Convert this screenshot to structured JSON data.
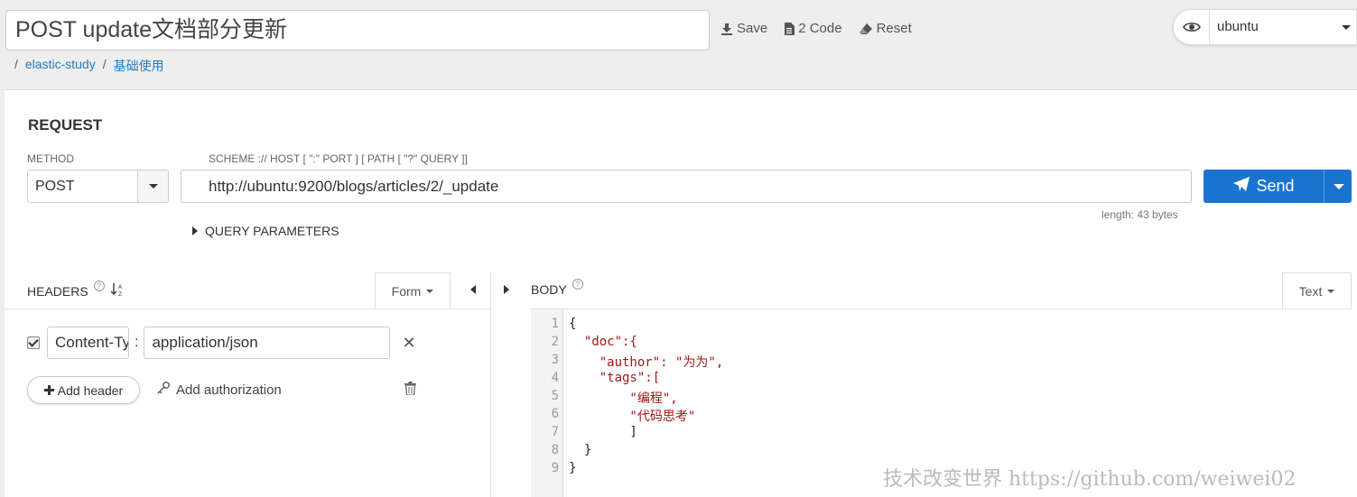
{
  "header": {
    "title": "POST update文档部分更新",
    "save_label": "Save",
    "code_label": "2 Code",
    "reset_label": "Reset"
  },
  "environment": {
    "selected": "ubuntu"
  },
  "breadcrumb": {
    "sep": "/",
    "items": [
      "elastic-study",
      "基础使用"
    ]
  },
  "request": {
    "section_title": "REQUEST",
    "method_label": "METHOD",
    "method_value": "POST",
    "url_label": "SCHEME :// HOST [ \":\" PORT ] [ PATH [ \"?\" QUERY ]]",
    "url_value": "http://ubuntu:9200/blogs/articles/2/_update",
    "length_text": "length: 43 bytes",
    "send_label": "Send",
    "query_params_label": "QUERY PARAMETERS"
  },
  "headers": {
    "title": "HEADERS",
    "mode_label": "Form",
    "rows": [
      {
        "key": "Content-Type",
        "value": "application/json",
        "enabled": true
      }
    ],
    "add_header_label": "Add header",
    "add_auth_label": "Add authorization"
  },
  "body": {
    "title": "BODY",
    "mode_label": "Text",
    "line_numbers": [
      "1",
      "2",
      "3",
      "4",
      "5",
      "6",
      "7",
      "8",
      "9"
    ],
    "lines": [
      "{",
      "  \"doc\":{",
      "    \"author\": \"为为\",",
      "    \"tags\":[",
      "        \"编程\",",
      "        \"代码思考\"",
      "        ]",
      "  }",
      "}"
    ]
  },
  "watermark": "技术改变世界 https://github.com/weiwei02",
  "colors": {
    "accent": "#1a73d1",
    "link": "#1a7ec8",
    "string": "#a31515"
  }
}
